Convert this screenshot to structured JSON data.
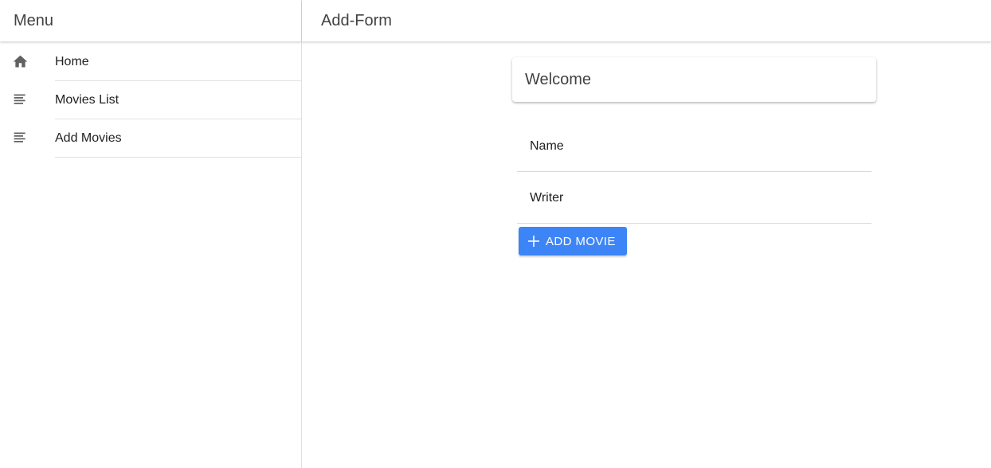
{
  "sidebar": {
    "title": "Menu",
    "items": [
      {
        "label": "Home",
        "icon": "home-icon"
      },
      {
        "label": "Movies List",
        "icon": "list-icon"
      },
      {
        "label": "Add Movies",
        "icon": "list-icon"
      }
    ]
  },
  "main": {
    "title": "Add-Form",
    "welcome": "Welcome",
    "fields": {
      "name": {
        "label": "Name",
        "value": ""
      },
      "writer": {
        "label": "Writer",
        "value": ""
      }
    },
    "add_button_label": "ADD MOVIE"
  },
  "colors": {
    "accent": "#3d85f7",
    "icon": "#616161",
    "divider": "#e0e0e0"
  }
}
